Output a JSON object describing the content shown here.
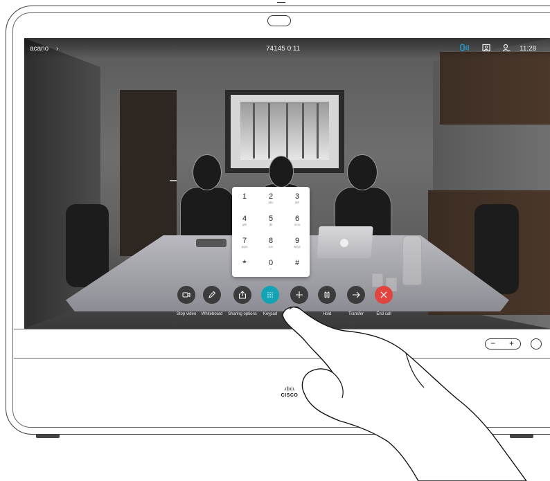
{
  "topbar": {
    "meeting_name": "acano",
    "chevron": "chevron-right-icon",
    "call_info": "74145  0:11",
    "icons": [
      "mic-indicator-icon",
      "selfview-icon",
      "participants-icon"
    ],
    "time": "11:28"
  },
  "keypad": {
    "keys": [
      {
        "digit": "1",
        "letters": ""
      },
      {
        "digit": "2",
        "letters": "abc"
      },
      {
        "digit": "3",
        "letters": "def"
      },
      {
        "digit": "4",
        "letters": "ghi"
      },
      {
        "digit": "5",
        "letters": "jkl"
      },
      {
        "digit": "6",
        "letters": "mno"
      },
      {
        "digit": "7",
        "letters": "pqrs"
      },
      {
        "digit": "8",
        "letters": "tuv"
      },
      {
        "digit": "9",
        "letters": "wxyz"
      },
      {
        "digit": "*",
        "letters": ""
      },
      {
        "digit": "0",
        "letters": "+"
      },
      {
        "digit": "#",
        "letters": ""
      }
    ]
  },
  "controls": {
    "stop_video": {
      "label": "Stop video",
      "icon": "camera-icon"
    },
    "whiteboard": {
      "label": "Whiteboard",
      "icon": "pen-icon"
    },
    "sharing": {
      "label": "Sharing options",
      "icon": "share-icon"
    },
    "keypad": {
      "label": "Keypad",
      "icon": "keypad-icon"
    },
    "add": {
      "label": "",
      "icon": "plus-icon"
    },
    "hold": {
      "label": "Hold",
      "icon": "pause-icon"
    },
    "transfer": {
      "label": "Transfer",
      "icon": "arrow-right-icon"
    },
    "end_call": {
      "label": "End call",
      "icon": "close-icon"
    }
  },
  "colors": {
    "keypad_active": "#14a3b5",
    "end_call": "#e0453f",
    "mic_indicator": "#1ea7e1"
  },
  "brand": {
    "logo_text": "CISCO"
  }
}
